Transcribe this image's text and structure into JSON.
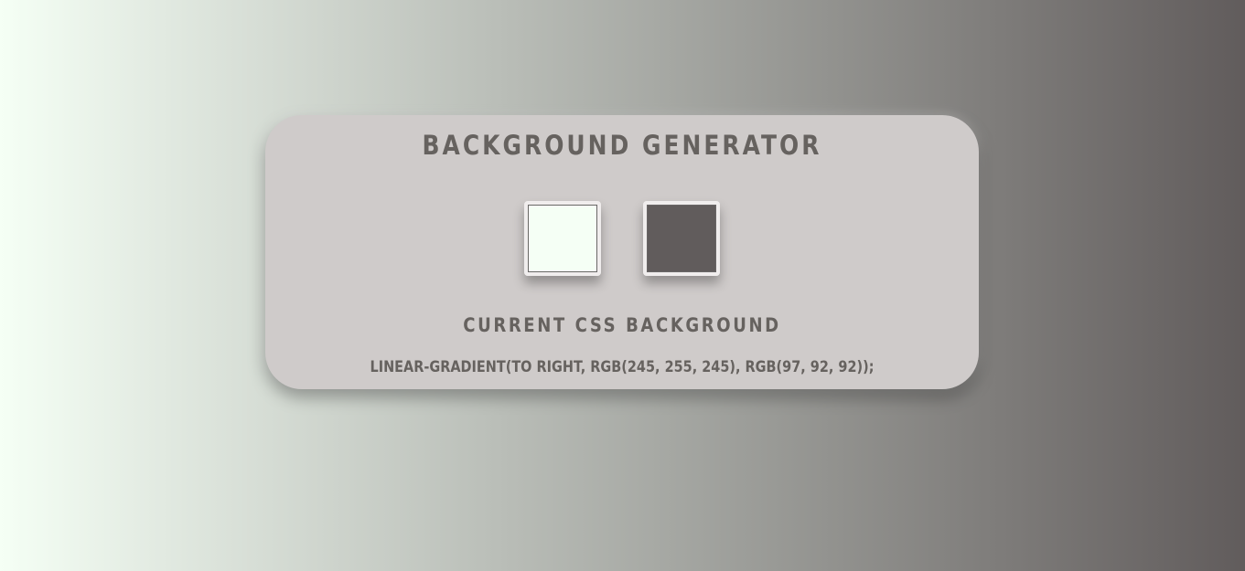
{
  "page": {
    "gradient_start": "#f5fff5",
    "gradient_end": "#615c5c"
  },
  "card": {
    "title": "BACKGROUND GENERATOR",
    "subtitle": "CURRENT CSS BACKGROUND",
    "css_text": "LINEAR-GRADIENT(TO RIGHT, RGB(245, 255, 245), RGB(97, 92, 92));"
  },
  "colors": {
    "color1": "#f5fff5",
    "color2": "#615c5c",
    "card_bg": "#cfcbca",
    "text": "#66625f"
  }
}
